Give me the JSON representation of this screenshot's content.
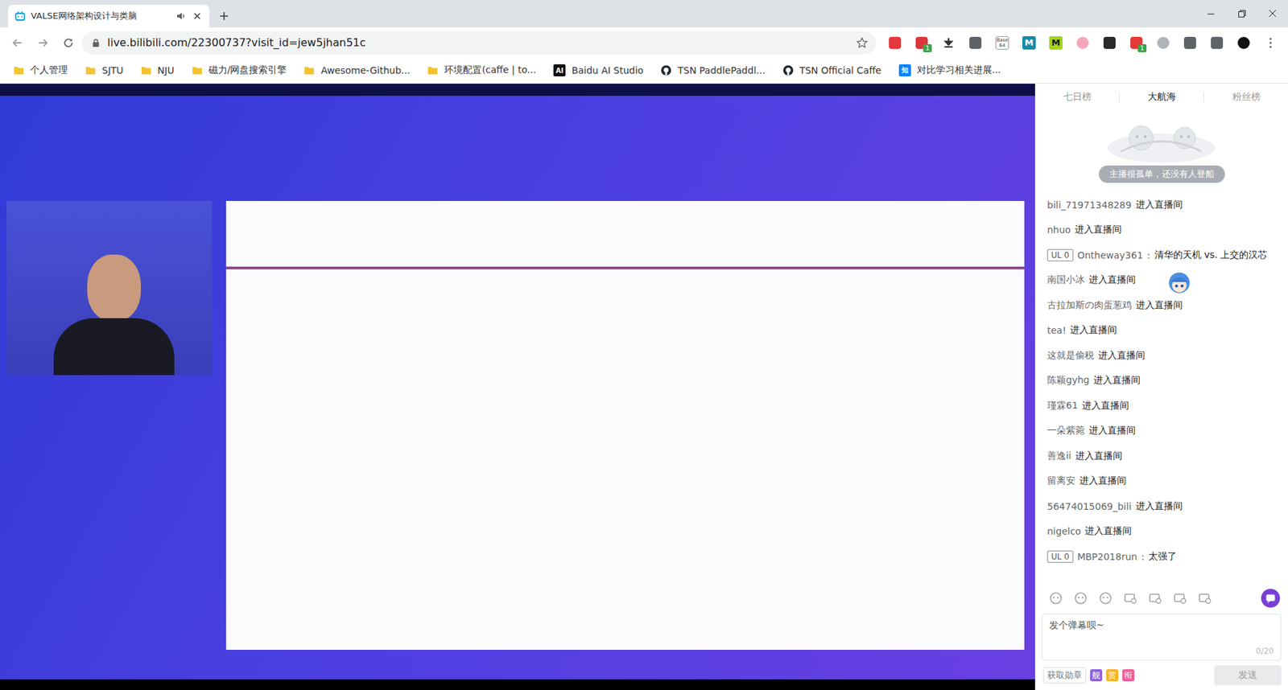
{
  "browser": {
    "tabs": [
      {
        "title": "VALSE网络架构设计与类脑",
        "selected": true,
        "playing_audio": true
      }
    ],
    "url": "live.bilibili.com/22300737?visit_id=jew5jhan51c",
    "bookmarked": false,
    "extensions": [
      {
        "kind": "square",
        "glyph": "",
        "badge": "",
        "color": "#e4393c",
        "ink": "#ffffff"
      },
      {
        "kind": "square",
        "glyph": "",
        "badge": "1",
        "color": "#d9363e",
        "ink": "#ffffff"
      },
      {
        "kind": "arrow",
        "glyph": "",
        "badge": "",
        "color": "#333333",
        "ink": "#ffffff"
      },
      {
        "kind": "square",
        "glyph": "",
        "badge": "",
        "color": "#5f6368",
        "ink": "#ffffff"
      },
      {
        "kind": "letter",
        "glyph": "Base 64",
        "badge": "",
        "color": "#ffffff",
        "ink": "#333333"
      },
      {
        "kind": "letter",
        "glyph": "M",
        "badge": "",
        "color": "#1a8aa8",
        "ink": "#ffffff"
      },
      {
        "kind": "letter",
        "glyph": "M",
        "badge": "",
        "color": "#a4d31f",
        "ink": "#1a1a1a"
      },
      {
        "kind": "circle",
        "glyph": "",
        "badge": "",
        "color": "#f4a6b8",
        "ink": "#ffffff"
      },
      {
        "kind": "square",
        "glyph": "",
        "badge": "",
        "color": "#2b2b2b",
        "ink": "#ffffff"
      },
      {
        "kind": "square",
        "glyph": "",
        "badge": "1",
        "color": "#e53935",
        "ink": "#ffffff"
      },
      {
        "kind": "circle",
        "glyph": "",
        "badge": "",
        "color": "#b0b4b8",
        "ink": "#ffffff"
      },
      {
        "kind": "square",
        "glyph": "",
        "badge": "",
        "color": "#5f6368",
        "ink": "#ffffff"
      },
      {
        "kind": "square",
        "glyph": "",
        "badge": "",
        "color": "#5f6368",
        "ink": "#ffffff"
      },
      {
        "kind": "circle",
        "glyph": "",
        "badge": "",
        "color": "#111111",
        "ink": "#ffffff"
      }
    ],
    "bookmarks": [
      {
        "kind": "folder",
        "label": "个人管理",
        "glyph": "",
        "color": "#f4c430"
      },
      {
        "kind": "folder",
        "label": "SJTU",
        "glyph": "",
        "color": "#f4c430"
      },
      {
        "kind": "folder",
        "label": "NJU",
        "glyph": "",
        "color": "#f4c430"
      },
      {
        "kind": "folder",
        "label": "磁力/网盘搜索引擎",
        "glyph": "",
        "color": "#f4c430"
      },
      {
        "kind": "folder",
        "label": "Awesome-Github...",
        "glyph": "",
        "color": "#f4c430"
      },
      {
        "kind": "folder",
        "label": "环境配置(caffe | to...",
        "glyph": "",
        "color": "#f4c430"
      },
      {
        "kind": "logo",
        "label": "Baidu AI Studio",
        "glyph": "AI",
        "color": "#111111"
      },
      {
        "kind": "github",
        "label": "TSN PaddlePaddl...",
        "glyph": "",
        "color": "#24292e"
      },
      {
        "kind": "github",
        "label": "TSN Official Caffe",
        "glyph": "",
        "color": "#24292e"
      },
      {
        "kind": "logo",
        "label": "对比学习相关进展...",
        "glyph": "知",
        "color": "#0a84ff"
      }
    ]
  },
  "ranking": {
    "tabs": [
      {
        "label": "七日榜",
        "selected": false
      },
      {
        "label": "大航海",
        "selected": true
      },
      {
        "label": "粉丝榜",
        "selected": false
      }
    ],
    "empty_text": "主播很孤单，还没有人登船"
  },
  "chat": [
    {
      "kind": "enter",
      "user": "bili_71971348289",
      "text": "进入直播间"
    },
    {
      "kind": "enter",
      "user": "nhuo",
      "text": "进入直播间"
    },
    {
      "kind": "message",
      "level": "UL 0",
      "user": "Ontheway361",
      "sep": ":",
      "text": "清华的天机 vs. 上交的汉芯"
    },
    {
      "kind": "enter",
      "user": "南国小冰",
      "text": "进入直播间"
    },
    {
      "kind": "enter",
      "user": "古拉加斯の肉蛋葱鸡",
      "text": "进入直播间"
    },
    {
      "kind": "enter",
      "user": "tea!",
      "text": "进入直播间"
    },
    {
      "kind": "enter",
      "user": "这就是偷税",
      "text": "进入直播间"
    },
    {
      "kind": "enter",
      "user": "陈颖gyhg",
      "text": "进入直播间"
    },
    {
      "kind": "enter",
      "user": "瑾霖61",
      "text": "进入直播间"
    },
    {
      "kind": "enter",
      "user": "一朵紫菀",
      "text": "进入直播间"
    },
    {
      "kind": "enter",
      "user": "善逸ii",
      "text": "进入直播间"
    },
    {
      "kind": "enter",
      "user": "留离安",
      "text": "进入直播间"
    },
    {
      "kind": "enter",
      "user": "56474015069_bili",
      "text": "进入直播间"
    },
    {
      "kind": "enter",
      "user": "nigelco",
      "text": "进入直播间"
    },
    {
      "kind": "message",
      "level": "UL 0",
      "user": "MBP2018run",
      "sep": ":",
      "text": "太强了"
    }
  ],
  "composer": {
    "placeholder": "发个弹幕呗~",
    "counter": "0/20",
    "medal_button": "获取勋章",
    "badges": [
      {
        "label": "舰",
        "color": "#8e63d8"
      },
      {
        "label": "赏",
        "color": "#f5b521"
      },
      {
        "label": "衔",
        "color": "#f0609a"
      }
    ],
    "send": {
      "label": "发送",
      "disabled": true
    }
  }
}
